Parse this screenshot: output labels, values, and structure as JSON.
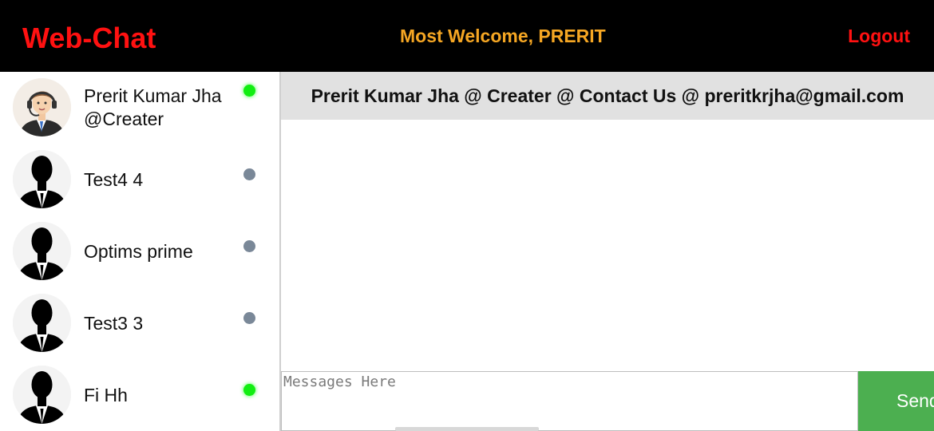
{
  "header": {
    "brand": "Web-Chat",
    "welcome": "Most Welcome, PRERIT",
    "logout_label": "Logout"
  },
  "contacts": [
    {
      "name_line1": "Prerit Kumar Jha",
      "name_line2": "@Creater",
      "status": "online",
      "avatar": "support-agent-avatar"
    },
    {
      "name_line1": "Test4 4",
      "name_line2": "",
      "status": "offline",
      "avatar": "user-silhouette-avatar"
    },
    {
      "name_line1": "Optims prime",
      "name_line2": "",
      "status": "offline",
      "avatar": "user-silhouette-avatar"
    },
    {
      "name_line1": "Test3 3",
      "name_line2": "",
      "status": "offline",
      "avatar": "user-silhouette-avatar"
    },
    {
      "name_line1": "Fi Hh",
      "name_line2": "",
      "status": "online",
      "avatar": "user-silhouette-avatar"
    }
  ],
  "chat": {
    "header_text": "Prerit Kumar Jha @ Creater @ Contact Us @ preritkrjha@gmail.com",
    "input_placeholder": "Messages Here",
    "send_label": "Send"
  },
  "colors": {
    "topbar_bg": "#000000",
    "brand": "#ff1111",
    "welcome": "#f5a623",
    "online": "#11ee11",
    "offline": "#7a8898",
    "send_bg": "#4caf50",
    "chat_header_bg": "#e1e1e1"
  }
}
